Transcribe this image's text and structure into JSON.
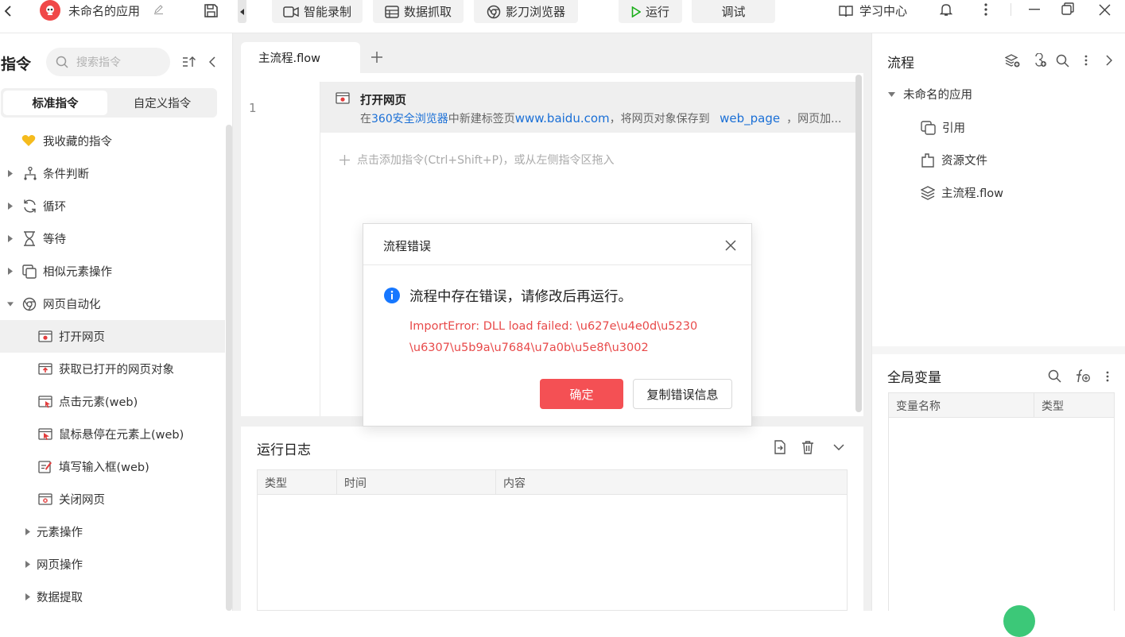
{
  "colors": {
    "accent": "#1677ff",
    "danger": "#f45054",
    "error_text": "#e84a4a",
    "run_green": "#1aad19",
    "link_blue": "#1a6fd6"
  },
  "topbar": {
    "app_name": "未命名的应用",
    "record_label": "智能录制",
    "scrape_label": "数据抓取",
    "browser_label": "影刀浏览器",
    "run_label": "运行",
    "debug_label": "调试",
    "learn_label": "学习中心"
  },
  "left": {
    "title": "指令",
    "search_placeholder": "搜索指令",
    "tab_standard": "标准指令",
    "tab_custom": "自定义指令",
    "items": [
      {
        "label": "我收藏的指令",
        "icon": "heart-icon"
      },
      {
        "label": "条件判断",
        "icon": "branch-icon"
      },
      {
        "label": "循环",
        "icon": "loop-icon"
      },
      {
        "label": "等待",
        "icon": "hourglass-icon"
      },
      {
        "label": "相似元素操作",
        "icon": "copy-elements-icon"
      },
      {
        "label": "网页自动化",
        "icon": "browser-globe-icon"
      },
      {
        "label": "打开网页",
        "icon": "open-webpage-icon"
      },
      {
        "label": "获取已打开的网页对象",
        "icon": "get-webpage-icon"
      },
      {
        "label": "点击元素(web)",
        "icon": "click-element-icon"
      },
      {
        "label": "鼠标悬停在元素上(web)",
        "icon": "hover-element-icon"
      },
      {
        "label": "填写输入框(web)",
        "icon": "fill-input-icon"
      },
      {
        "label": "关闭网页",
        "icon": "close-webpage-icon"
      },
      {
        "label": "元素操作",
        "icon": ""
      },
      {
        "label": "网页操作",
        "icon": ""
      },
      {
        "label": "数据提取",
        "icon": ""
      }
    ]
  },
  "editor": {
    "tab_label": "主流程.flow",
    "line_number": "1",
    "step_title": "打开网页",
    "step_desc_prefix": "在",
    "step_desc_browser": "360安全浏览器",
    "step_desc_mid": "中新建标签页",
    "step_desc_url": "www.baidu.com",
    "step_desc_mid2": "，将网页对象保存到",
    "step_desc_var": "web_page",
    "step_desc_tail": "，网页加...",
    "add_hint": "点击添加指令(Ctrl+Shift+P)，或从左侧指令区拖入"
  },
  "log": {
    "title": "运行日志",
    "columns": [
      "类型",
      "时间",
      "内容"
    ]
  },
  "right": {
    "flow_title": "流程",
    "tree_root": "未命名的应用",
    "tree_items": [
      {
        "label": "引用",
        "icon": "reference-icon"
      },
      {
        "label": "资源文件",
        "icon": "resource-file-icon"
      },
      {
        "label": "主流程.flow",
        "icon": "layers-icon"
      }
    ],
    "vars_title": "全局变量",
    "var_columns": [
      "变量名称",
      "类型"
    ]
  },
  "dialog": {
    "title": "流程错误",
    "message": "流程中存在错误，请修改后再运行。",
    "error_line1": "ImportError: DLL load failed: \\u627e\\u4e0d\\u5230",
    "error_line2": "\\u6307\\u5b9a\\u7684\\u7a0b\\u5e8f\\u3002",
    "ok_label": "确定",
    "copy_label": "复制错误信息"
  }
}
